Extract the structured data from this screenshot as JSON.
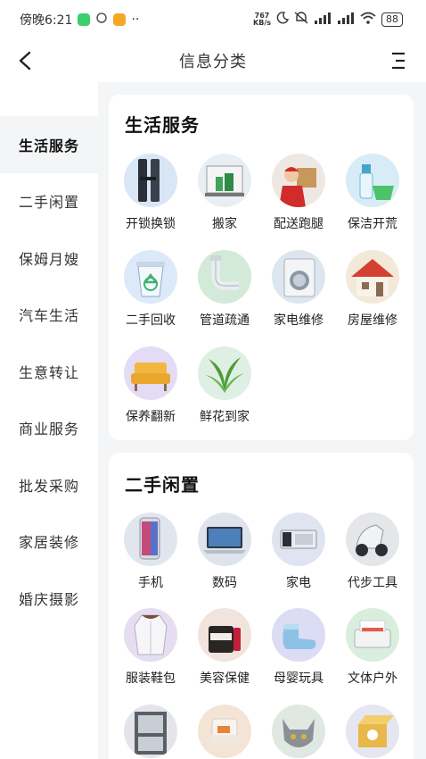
{
  "status_bar": {
    "time": "傍晚6:21",
    "more": "··",
    "net_speed_top": "767",
    "net_speed_bottom": "KB/s",
    "battery": "88"
  },
  "nav": {
    "title": "信息分类"
  },
  "sidebar": {
    "items": [
      {
        "label": "生活服务",
        "active": true
      },
      {
        "label": "二手闲置",
        "active": false
      },
      {
        "label": "保姆月嫂",
        "active": false
      },
      {
        "label": "汽车生活",
        "active": false
      },
      {
        "label": "生意转让",
        "active": false
      },
      {
        "label": "商业服务",
        "active": false
      },
      {
        "label": "批发采购",
        "active": false
      },
      {
        "label": "家居装修",
        "active": false
      },
      {
        "label": "婚庆摄影",
        "active": false
      }
    ]
  },
  "sections": [
    {
      "title": "生活服务",
      "items": [
        {
          "label": "开锁换锁",
          "icon": "door-lock-icon"
        },
        {
          "label": "搬家",
          "icon": "moving-truck-icon"
        },
        {
          "label": "配送跑腿",
          "icon": "courier-icon"
        },
        {
          "label": "保洁开荒",
          "icon": "cleaning-bottle-icon"
        },
        {
          "label": "二手回收",
          "icon": "recycle-bin-icon"
        },
        {
          "label": "管道疏通",
          "icon": "pipe-icon"
        },
        {
          "label": "家电维修",
          "icon": "washing-machine-icon"
        },
        {
          "label": "房屋维修",
          "icon": "house-icon"
        },
        {
          "label": "保养翻新",
          "icon": "sofa-icon"
        },
        {
          "label": "鲜花到家",
          "icon": "plant-icon"
        }
      ]
    },
    {
      "title": "二手闲置",
      "items": [
        {
          "label": "手机",
          "icon": "phone-icon"
        },
        {
          "label": "数码",
          "icon": "laptop-icon"
        },
        {
          "label": "家电",
          "icon": "appliance-icon"
        },
        {
          "label": "代步工具",
          "icon": "scooter-icon"
        },
        {
          "label": "服装鞋包",
          "icon": "coat-icon"
        },
        {
          "label": "美容保健",
          "icon": "cosmetics-icon"
        },
        {
          "label": "母婴玩具",
          "icon": "baby-shoe-icon"
        },
        {
          "label": "文体户外",
          "icon": "printer-icon"
        },
        {
          "label": "",
          "icon": "cabinet-icon"
        },
        {
          "label": "",
          "icon": "chair-icon"
        },
        {
          "label": "",
          "icon": "cat-icon"
        },
        {
          "label": "",
          "icon": "mystery-box-icon"
        }
      ]
    }
  ]
}
